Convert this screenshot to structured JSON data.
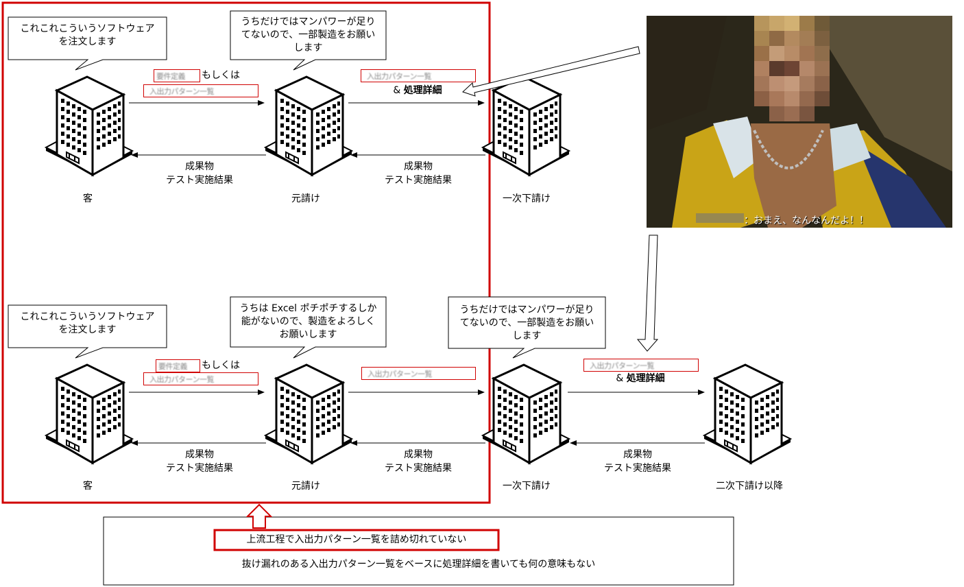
{
  "bubbles": {
    "top_client": [
      "これこれこういうソフトウェア",
      "を注文します"
    ],
    "top_prime": [
      "うちだけではマンパワーが足り",
      "てないので、一部製造をお願い",
      "します"
    ],
    "bottom_client": [
      "これこれこういうソフトウェア",
      "を注文します"
    ],
    "bottom_prime": [
      "うちは Excel ポチポチするしか",
      "能がないので、製造をよろしく",
      "お願いします"
    ],
    "bottom_sub1": [
      "うちだけではマンパワーが足り",
      "てないので、一部製造をお願い",
      "します"
    ]
  },
  "nodes": {
    "client": "客",
    "prime": "元請け",
    "sub1": "一次下請け",
    "sub2": "二次下請け以降"
  },
  "arrows": {
    "requirements": "要件定義",
    "or": "もしくは",
    "io_list": "入出力パターン一覧",
    "amp": "& ",
    "detail": "処理詳細",
    "deliverable": "成果物",
    "test_result": "テスト実施結果"
  },
  "photo": {
    "subtitle": "：おまえ、なんなんだよ！！"
  },
  "note": {
    "highlight": "上流工程で入出力パターン一覧を詰め切れていない",
    "body": "抜け漏れのある入出力パターン一覧をベースに処理詳細を書いても何の意味もない"
  },
  "colors": {
    "accent_red": "#d00000",
    "line": "#000000"
  }
}
